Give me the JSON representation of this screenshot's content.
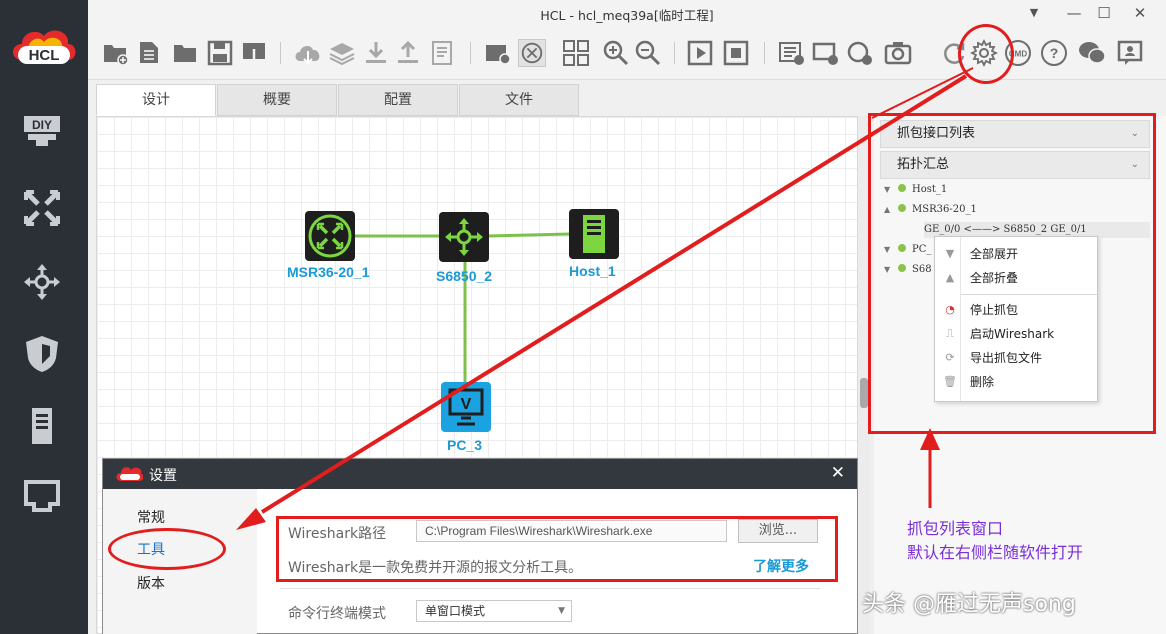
{
  "window": {
    "title": "HCL - hcl_meq39a[临时工程]",
    "controls": [
      "minimize-menu",
      "minimize",
      "maximize",
      "close"
    ]
  },
  "app": {
    "logo_text": "HCL"
  },
  "sidebar": {
    "items": [
      {
        "label": "DIY",
        "icon": "diy-icon"
      },
      {
        "icon": "router-icon"
      },
      {
        "icon": "switch-icon"
      },
      {
        "icon": "firewall-icon"
      },
      {
        "icon": "server-icon"
      },
      {
        "icon": "network-cable-icon"
      }
    ]
  },
  "toolbar": {
    "icons": [
      "new-project-icon",
      "open-project-icon",
      "open-folder-icon",
      "save-icon",
      "export-icon",
      "cloud-icon",
      "layers-icon",
      "download-icon",
      "upload-icon",
      "notes-icon",
      "screenshot-icon",
      "topology-icon",
      "grid-icon",
      "zoom-in-icon",
      "zoom-out-icon",
      "play-icon",
      "stop-icon",
      "add-text-icon",
      "add-rect-icon",
      "add-ellipse-icon",
      "camera-icon",
      "refresh-icon",
      "settings-icon",
      "cmd-icon",
      "help-icon",
      "wechat-icon",
      "feedback-icon"
    ],
    "cmd_label": "CMD"
  },
  "tabs": [
    {
      "label": "设计",
      "active": true
    },
    {
      "label": "概要",
      "active": false
    },
    {
      "label": "配置",
      "active": false
    },
    {
      "label": "文件",
      "active": false
    }
  ],
  "topology": {
    "nodes": [
      {
        "name": "MSR36-20_1",
        "type": "router"
      },
      {
        "name": "S6850_2",
        "type": "switch"
      },
      {
        "name": "Host_1",
        "type": "host"
      },
      {
        "name": "PC_3",
        "type": "pc",
        "icon_letter": "V"
      }
    ],
    "link_color": "#7cc24a"
  },
  "right_panel": {
    "capture_list_title": "抓包接口列表",
    "topology_summary_title": "拓扑汇总",
    "tree": [
      {
        "label": "Host_1",
        "expanded": false
      },
      {
        "label": "MSR36-20_1",
        "expanded": true
      },
      {
        "label": "GE_0/0 <——> S6850_2 GE_0/1",
        "child": true
      },
      {
        "label": "PC_",
        "expanded": false
      },
      {
        "label": "S68",
        "expanded": false
      }
    ],
    "status_color": "#8bc34a"
  },
  "context_menu": {
    "items": [
      {
        "label": "全部展开",
        "icon": "expand-all-icon"
      },
      {
        "label": "全部折叠",
        "icon": "collapse-all-icon"
      },
      {
        "label": "停止抓包",
        "icon": "stop-capture-icon"
      },
      {
        "label": "启动Wireshark",
        "icon": "wireshark-icon"
      },
      {
        "label": "导出抓包文件",
        "icon": "export-capture-icon"
      },
      {
        "label": "删除",
        "icon": "delete-icon"
      }
    ]
  },
  "settings_dialog": {
    "title": "设置",
    "nav": [
      "常规",
      "工具",
      "版本"
    ],
    "selected_nav": "工具",
    "wireshark_label": "Wireshark路径",
    "wireshark_path": "C:\\Program Files\\Wireshark\\Wireshark.exe",
    "browse_label": "浏览...",
    "description": "Wireshark是一款免费并开源的报文分析工具。",
    "learn_more": "了解更多",
    "terminal_label": "命令行终端模式",
    "terminal_value": "单窗口模式"
  },
  "annotations": {
    "caption_line1": "抓包列表窗口",
    "caption_line2": "默认在右侧栏随软件打开",
    "watermark": "头条 @雁过无声song",
    "color": "#e11d1d"
  }
}
